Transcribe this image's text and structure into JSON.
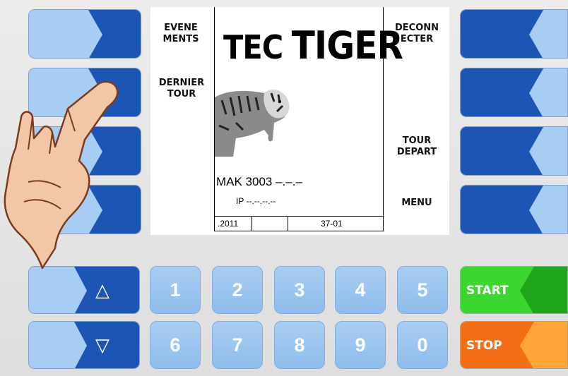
{
  "screen": {
    "left_labels": {
      "events": "EVENE\nMENTS",
      "last_tour": "DERNIER\nTOUR"
    },
    "right_labels": {
      "disconnect": "DECONN\nECTER",
      "tour_start": "TOUR\nDEPART",
      "menu": "MENU"
    },
    "brand": {
      "part1": "TEC",
      "part2": "TIGER"
    },
    "device": "MAK 3003 –.–.–",
    "ip": "IP --.--.--.--",
    "footer": {
      "date": ".2011",
      "code": "37-01"
    }
  },
  "nav": {
    "up_glyph": "△",
    "down_glyph": "▽"
  },
  "keypad": [
    "1",
    "2",
    "3",
    "4",
    "5",
    "6",
    "7",
    "8",
    "9",
    "0"
  ],
  "actions": {
    "start": "START",
    "stop": "STOP"
  },
  "colors": {
    "key_dark": "#1c55b4",
    "key_light": "#a6cbf3",
    "start": "#3bd62e",
    "stop": "#f46e16"
  }
}
